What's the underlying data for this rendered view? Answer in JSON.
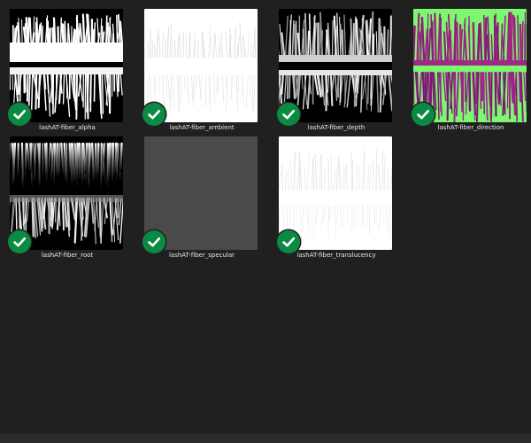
{
  "files": [
    {
      "name": "lashAT-fiber_alpha",
      "kind": "alpha",
      "synced": true
    },
    {
      "name": "lashAT-fiber_ambient",
      "kind": "ambient",
      "synced": true
    },
    {
      "name": "lashAT-fiber_depth",
      "kind": "depth",
      "synced": true
    },
    {
      "name": "lashAT-fiber_direction",
      "kind": "direction",
      "synced": true
    },
    {
      "name": "lashAT-fiber_root",
      "kind": "root",
      "synced": true
    },
    {
      "name": "lashAT-fiber_specular",
      "kind": "specular",
      "synced": true
    },
    {
      "name": "lashAT-fiber_translucency",
      "kind": "translucency",
      "synced": true
    }
  ],
  "status_icon": "checkmark-circle-icon",
  "colors": {
    "background": "#202020",
    "check_green": "#0b8a44",
    "direction_bg": "#7cf870",
    "direction_fiber": "#8a1f7a",
    "specular_fill": "#4a4a4a"
  }
}
